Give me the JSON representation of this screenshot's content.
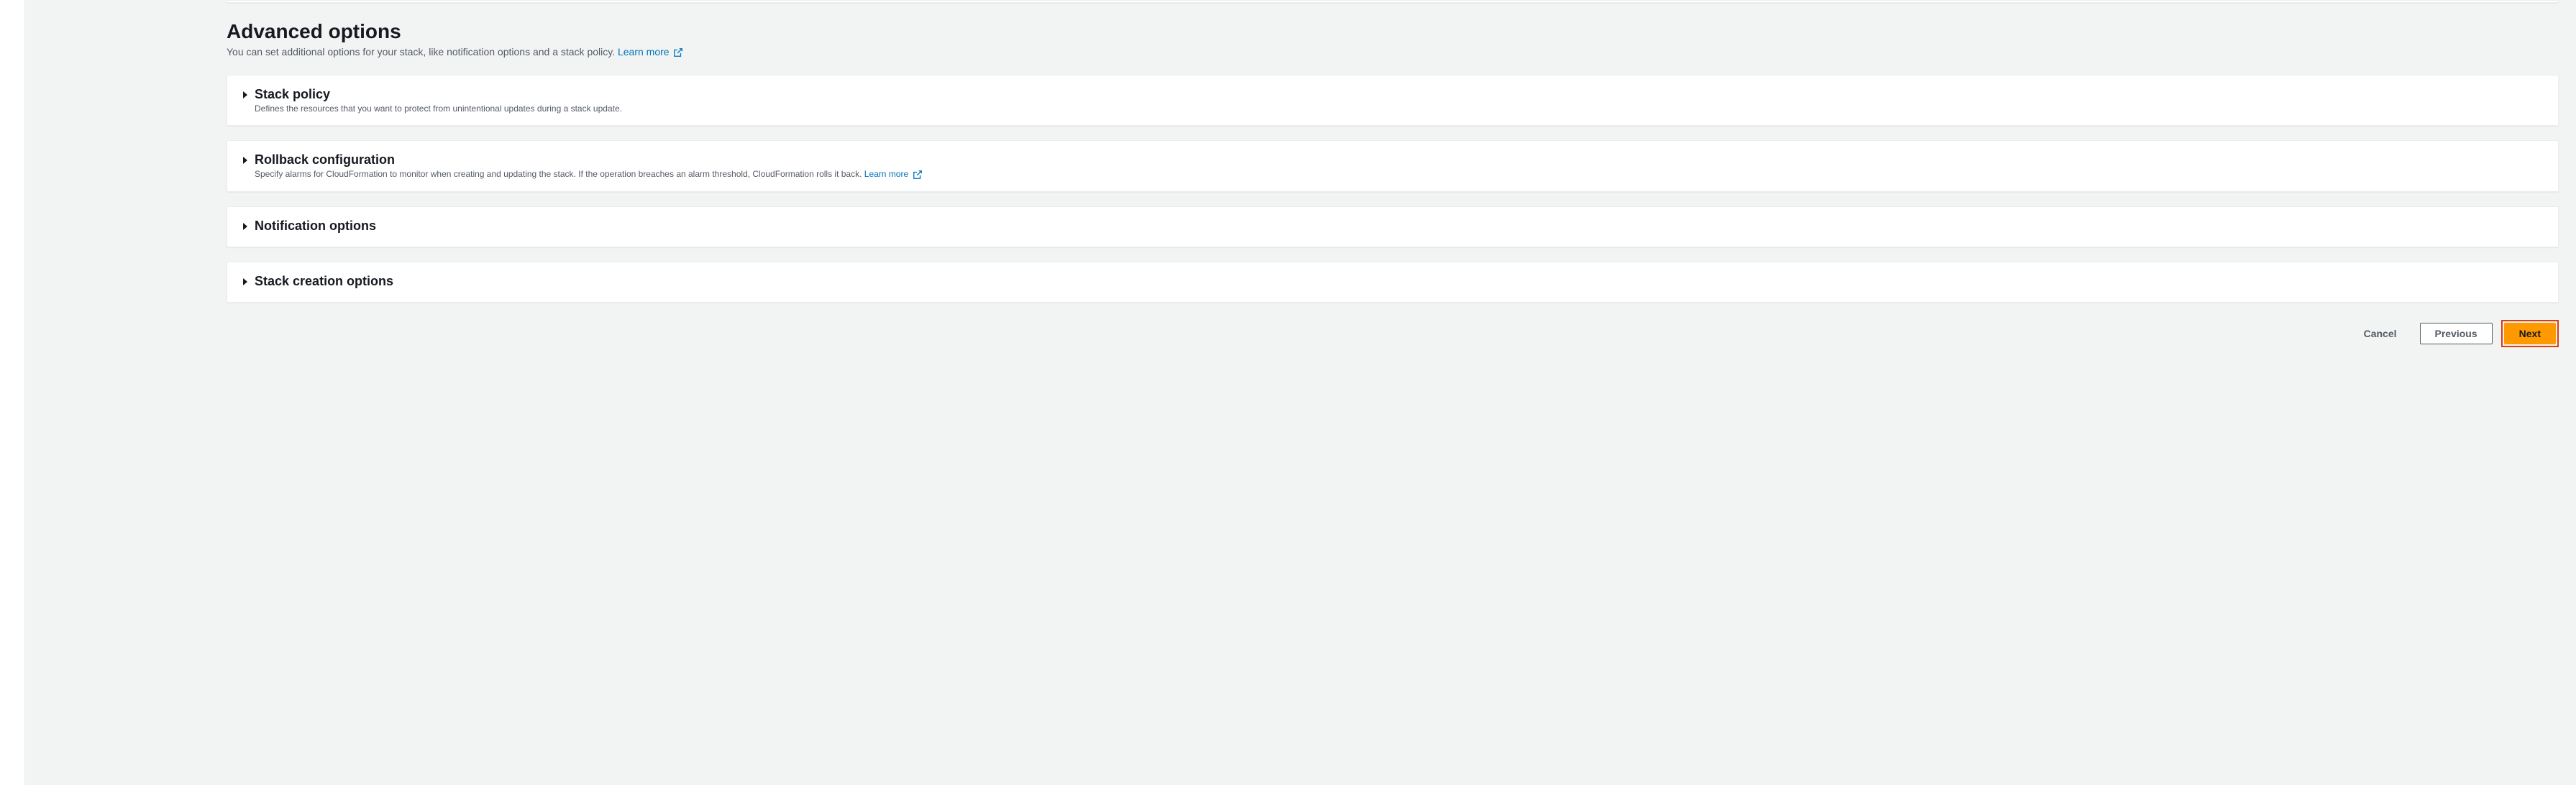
{
  "section": {
    "title": "Advanced options",
    "subtitle": "You can set additional options for your stack, like notification options and a stack policy.",
    "learn_more": "Learn more"
  },
  "panels": {
    "stack_policy": {
      "title": "Stack policy",
      "description": "Defines the resources that you want to protect from unintentional updates during a stack update."
    },
    "rollback_config": {
      "title": "Rollback configuration",
      "description": "Specify alarms for CloudFormation to monitor when creating and updating the stack. If the operation breaches an alarm threshold, CloudFormation rolls it back.",
      "learn_more": "Learn more"
    },
    "notification_options": {
      "title": "Notification options"
    },
    "stack_creation_options": {
      "title": "Stack creation options"
    }
  },
  "buttons": {
    "cancel": "Cancel",
    "previous": "Previous",
    "next": "Next"
  }
}
